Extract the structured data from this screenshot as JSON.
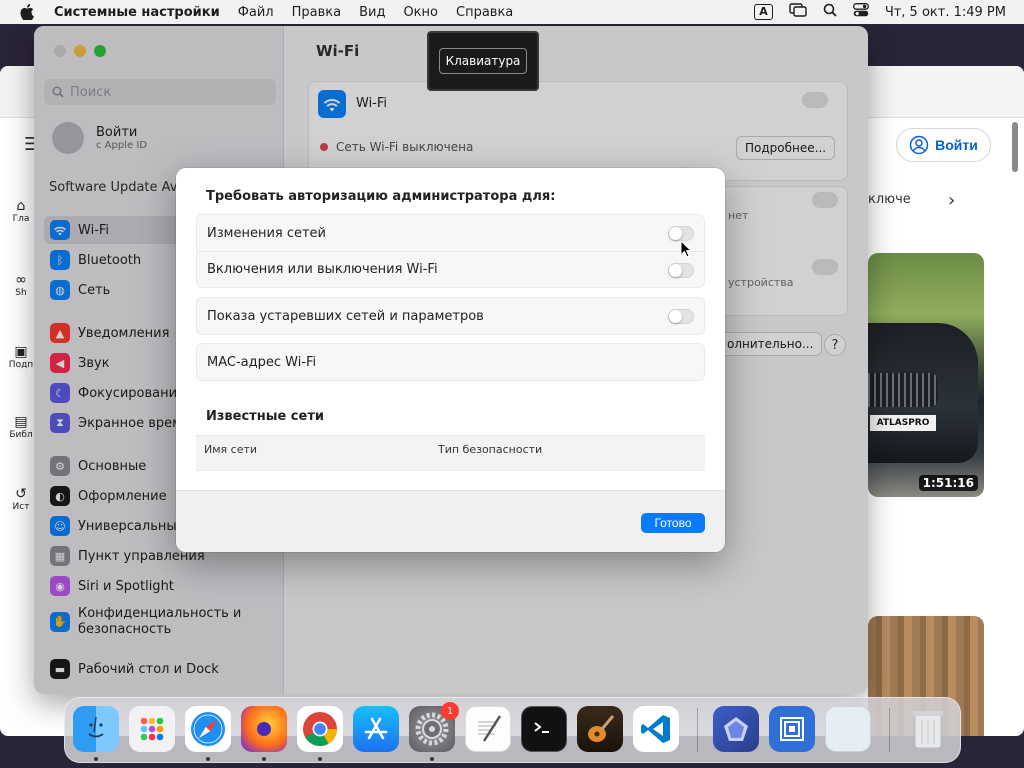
{
  "menubar": {
    "app_name": "Системные настройки",
    "items": [
      "Файл",
      "Правка",
      "Вид",
      "Окно",
      "Справка"
    ],
    "input_source": "A",
    "clock": "Чт, 5 окт.  1:49 PM"
  },
  "browser": {
    "nav_labels": [
      "Гла",
      "Sh",
      "Подп",
      "Библ",
      "Ист"
    ],
    "login_label": "Войти",
    "peek_text": "ключе",
    "video_duration": "1:51:16",
    "plate_text": "ATLASPRO"
  },
  "settings": {
    "search_placeholder": "Поиск",
    "apple_id_name": "Войти",
    "apple_id_sub": "с Apple ID",
    "software_update": "Software Update Ava",
    "sidebar_items": [
      {
        "label": "Wi-Fi",
        "icon": "wifi-icon",
        "color": "#0a84ff"
      },
      {
        "label": "Bluetooth",
        "icon": "bluetooth-icon",
        "color": "#0a84ff"
      },
      {
        "label": "Сеть",
        "icon": "globe-icon",
        "color": "#0a84ff"
      },
      {
        "label": "Уведомления",
        "icon": "bell-icon",
        "color": "#ff3b30"
      },
      {
        "label": "Звук",
        "icon": "speaker-icon",
        "color": "#ff2d55"
      },
      {
        "label": "Фокусирование",
        "icon": "moon-icon",
        "color": "#5e5ce6"
      },
      {
        "label": "Экранное время",
        "icon": "hourglass-icon",
        "color": "#5e5ce6"
      },
      {
        "label": "Основные",
        "icon": "gear-icon",
        "color": "#8e8e93"
      },
      {
        "label": "Оформление",
        "icon": "appearance-icon",
        "color": "#1c1c1e"
      },
      {
        "label": "Универсальный доступ",
        "icon": "accessibility-icon",
        "color": "#0a84ff"
      },
      {
        "label": "Пункт управления",
        "icon": "control-center-icon",
        "color": "#8e8e93"
      },
      {
        "label": "Siri и Spotlight",
        "icon": "siri-icon",
        "color": "#bf5af2"
      },
      {
        "label": "Конфиденциальность и безопасность",
        "icon": "hand-icon",
        "color": "#0a84ff"
      },
      {
        "label": "Рабочий стол и Dock",
        "icon": "dock-icon",
        "color": "#1c1c1e"
      }
    ],
    "main_title": "Wi-Fi",
    "wifi_label": "Wi-Fi",
    "wifi_off_status": "Сеть Wi-Fi выключена",
    "details_label": "Подробнее...",
    "peek_net": "нет",
    "peek_device": "устройства",
    "peek_advanced": "олнительно...",
    "help_label": "?"
  },
  "sheet": {
    "heading": "Требовать авторизацию администратора для:",
    "options_group1": [
      {
        "label": "Изменения сетей",
        "on": false
      },
      {
        "label": "Включения или выключения Wi-Fi",
        "on": false
      }
    ],
    "options_group2": [
      {
        "label": "Показа устаревших сетей и параметров",
        "on": false
      }
    ],
    "mac_label": "MAC-адрес Wi-Fi",
    "known_networks_title": "Известные сети",
    "table_columns": [
      "Имя сети",
      "Тип безопасности"
    ],
    "done_label": "Готово"
  },
  "hud": {
    "keyboard_label": "Клавиатура"
  },
  "dock": {
    "settings_badge": "1",
    "apps": [
      "finder",
      "launchpad",
      "safari",
      "firefox",
      "chrome",
      "app-store",
      "system-settings",
      "textedit",
      "terminal",
      "garageband",
      "vscode",
      "linear",
      "remote-desktop",
      "preview"
    ]
  }
}
